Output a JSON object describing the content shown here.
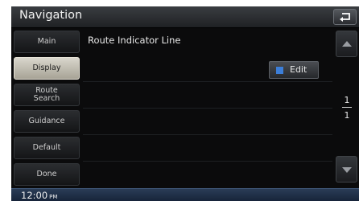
{
  "header": {
    "title": "Navigation",
    "back_icon": "back-arrow-icon"
  },
  "sidebar": {
    "items": [
      {
        "label": "Main",
        "active": false
      },
      {
        "label": "Display",
        "active": true
      },
      {
        "label": "Route Search",
        "active": false
      },
      {
        "label": "Guidance",
        "active": false
      },
      {
        "label": "Default",
        "active": false
      },
      {
        "label": "Done",
        "active": false
      }
    ]
  },
  "main": {
    "item_label": "Route Indicator Line",
    "edit_button": {
      "label": "Edit",
      "swatch_color": "#3c7ed8"
    }
  },
  "pager": {
    "current": "1",
    "total": "1",
    "up_icon": "scroll-up-arrow-icon",
    "down_icon": "scroll-down-arrow-icon"
  },
  "status": {
    "time": "12:00",
    "ampm": "PM"
  },
  "colors": {
    "active_tab": "#d9d6cc",
    "status_bar": "#1e2f48",
    "background": "#0b0b0c"
  }
}
